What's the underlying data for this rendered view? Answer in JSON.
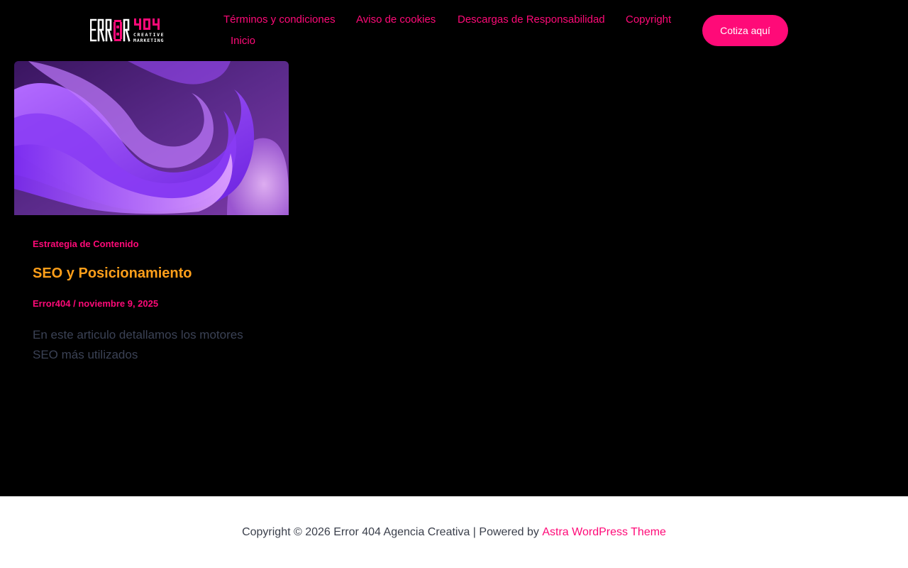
{
  "brand": {
    "logo_text": "ERROR 404",
    "logo_subtitle_line1": "CREATIVE",
    "logo_subtitle_line2": "MARKETING",
    "accent": "#ff0a78"
  },
  "nav": {
    "items": [
      {
        "label": "Términos y condiciones"
      },
      {
        "label": "Aviso de cookies"
      },
      {
        "label": "Descargas de Responsabilidad"
      },
      {
        "label": "Copyright"
      },
      {
        "label": "Inicio"
      }
    ],
    "cta_label": "Cotiza aquí"
  },
  "post": {
    "category": "Estrategia de Contenido",
    "title": "SEO y Posicionamiento",
    "author": "Error404",
    "separator": "/",
    "date": "noviembre 9, 2025",
    "excerpt": "En este articulo detallamos los motores SEO más utilizados",
    "title_color": "#ff9f1a"
  },
  "footer": {
    "copyright_text": "Copyright © 2026 Error 404 Agencia Creativa | Powered by",
    "theme_link": "Astra WordPress Theme"
  }
}
